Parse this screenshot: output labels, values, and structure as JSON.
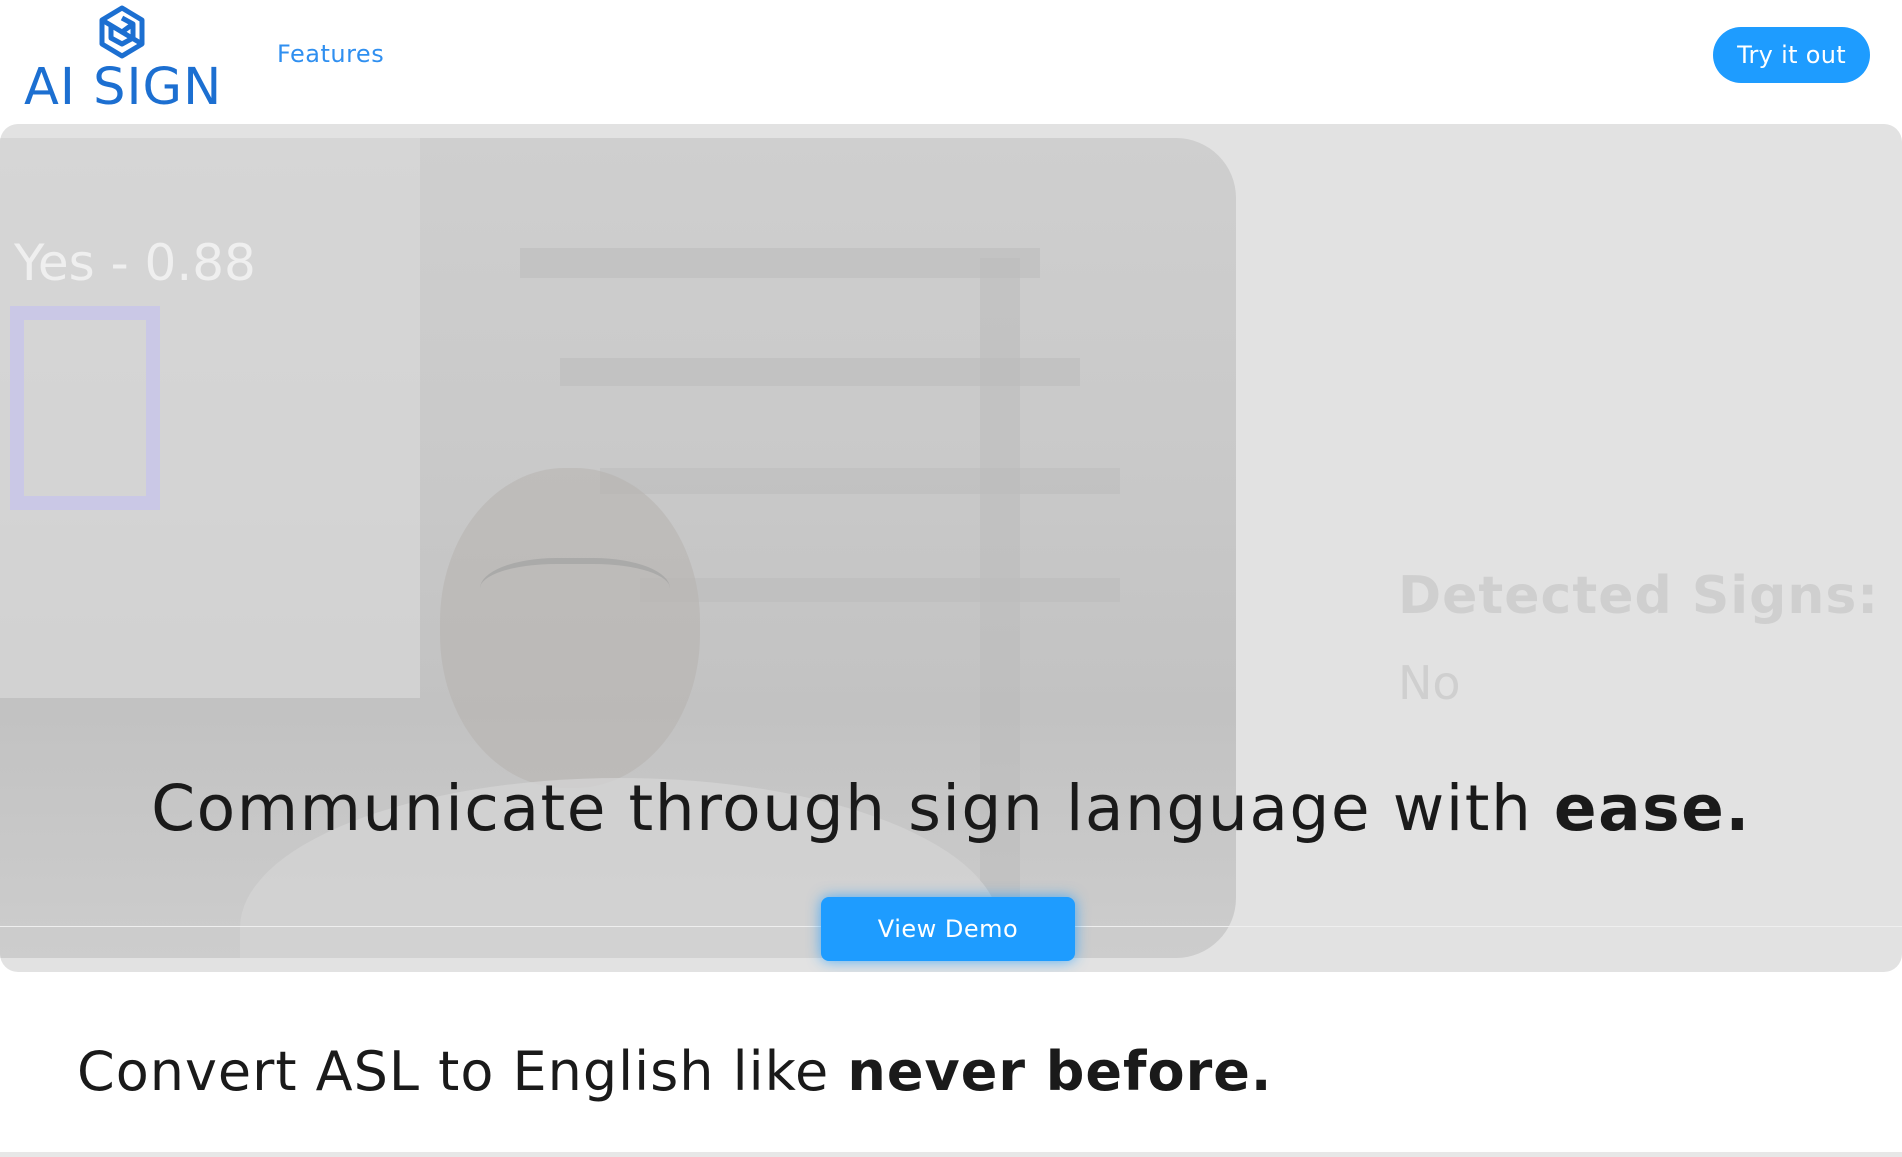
{
  "header": {
    "logo_text": "AI SIGN",
    "nav": {
      "features": "Features"
    },
    "cta": "Try it out"
  },
  "hero": {
    "video_overlay_label": "Yes - 0.88",
    "detected": {
      "title": "Detected Signs:",
      "value": "No"
    },
    "headline": {
      "text": "Communicate through sign language with ",
      "emphasis": "ease."
    },
    "demo_button": "View Demo"
  },
  "section": {
    "headline": {
      "text": "Convert ASL to English like ",
      "emphasis": "never before."
    }
  },
  "colors": {
    "brand_blue": "#1c6fd1",
    "link_blue": "#2f8ff0",
    "button_blue": "#1e9cff",
    "hero_bg": "#e2e2e2"
  },
  "icons": {
    "logo": "hexagon-spiral-icon"
  }
}
